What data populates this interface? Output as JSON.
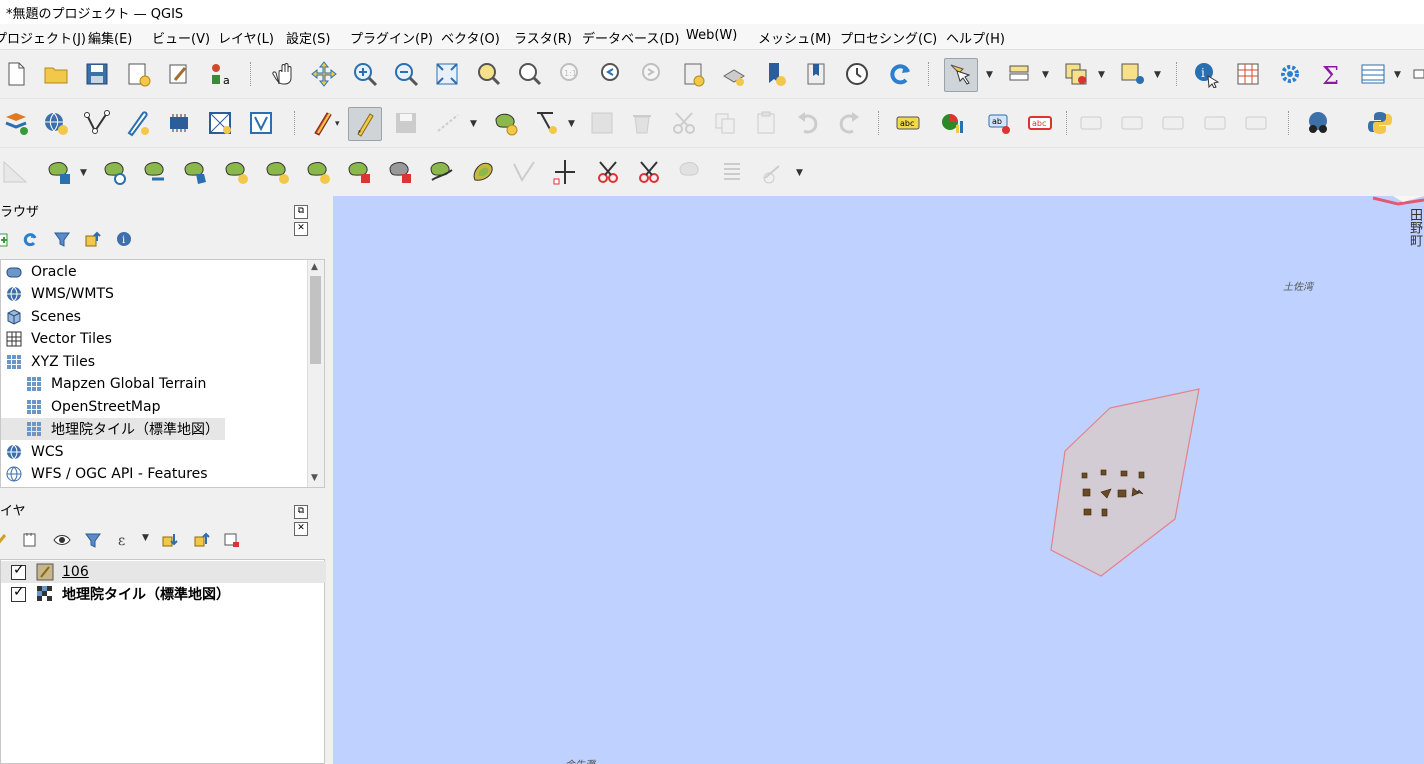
{
  "window": {
    "title": "*無題のプロジェクト — QGIS"
  },
  "menu": [
    "プロジェクト(J)",
    "編集(E)",
    "ビュー(V)",
    "レイヤ(L)",
    "設定(S)",
    "プラグイン(P)",
    "ベクタ(O)",
    "ラスタ(R)",
    "データベース(D)",
    "Web(W)",
    "メッシュ(M)",
    "プロセシング(C)",
    "ヘルプ(H)"
  ],
  "browser_panel": {
    "title": "ラウザ",
    "items": [
      {
        "label": "Oracle",
        "icon": "database-icon"
      },
      {
        "label": "WMS/WMTS",
        "icon": "globe-icon"
      },
      {
        "label": "Scenes",
        "icon": "cube-icon"
      },
      {
        "label": "Vector Tiles",
        "icon": "grid-icon"
      },
      {
        "label": "XYZ Tiles",
        "icon": "tiles-icon"
      },
      {
        "label": "Mapzen Global Terrain",
        "icon": "tiles-icon"
      },
      {
        "label": "OpenStreetMap",
        "icon": "tiles-icon"
      },
      {
        "label": "地理院タイル（標準地図）",
        "icon": "tiles-icon"
      },
      {
        "label": "WCS",
        "icon": "globe-icon"
      },
      {
        "label": "WFS / OGC API - Features",
        "icon": "globe-icon"
      }
    ]
  },
  "layers_panel": {
    "title": "イヤ",
    "layers": [
      {
        "name": "106",
        "checked": true,
        "icon": "polygon-layer-icon"
      },
      {
        "name": "地理院タイル（標準地図）",
        "checked": true,
        "icon": "raster-layer-icon"
      }
    ]
  },
  "map": {
    "background": "#bfd2ff",
    "labels": {
      "top_right": "土佐湾",
      "right_edge": "田野町",
      "bottom": "金生灘"
    }
  }
}
